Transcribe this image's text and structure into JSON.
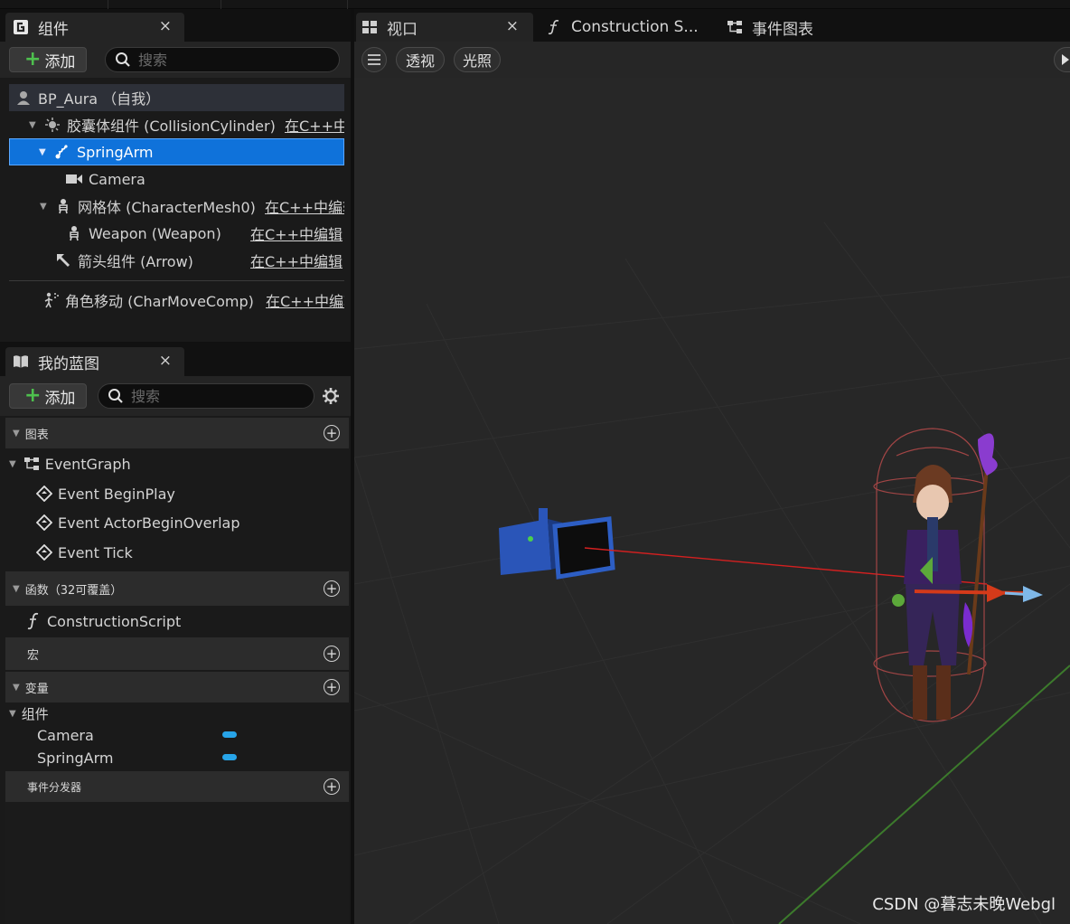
{
  "components_panel": {
    "tab_label": "组件",
    "add_label": "添加",
    "search_placeholder": "搜索",
    "tree": [
      {
        "label": "BP_Aura （自我）"
      },
      {
        "label": "胶囊体组件 (CollisionCylinder)",
        "edit": "在C++中"
      },
      {
        "label": "SpringArm"
      },
      {
        "label": "Camera"
      },
      {
        "label": "网格体 (CharacterMesh0)",
        "edit": "在C++中编辑"
      },
      {
        "label": "Weapon (Weapon)",
        "edit": "在C++中编辑"
      },
      {
        "label": "箭头组件 (Arrow)",
        "edit": "在C++中编辑"
      },
      {
        "label": "角色移动 (CharMoveComp)",
        "edit": "在C++中编辑"
      }
    ]
  },
  "blueprint_panel": {
    "tab_label": "我的蓝图",
    "add_label": "添加",
    "search_placeholder": "搜索",
    "graphs_label": "图表",
    "event_graph": "EventGraph",
    "events": [
      "Event BeginPlay",
      "Event ActorBeginOverlap",
      "Event Tick"
    ],
    "functions_label": "函数（32可覆盖）",
    "construction_script": "ConstructionScript",
    "macros_label": "宏",
    "variables_label": "变量",
    "components_group": "组件",
    "variables": [
      "Camera",
      "SpringArm"
    ],
    "dispatchers_label": "事件分发器"
  },
  "viewport": {
    "tabs": [
      "视口",
      "Construction S...",
      "事件图表"
    ],
    "perspective_label": "透视",
    "lighting_label": "光照"
  },
  "watermark": "CSDN @暮志未晚Webgl",
  "colors": {
    "selection": "#0f72da",
    "add_plus": "#4ec04e",
    "variable_pill": "#27a4e8"
  }
}
